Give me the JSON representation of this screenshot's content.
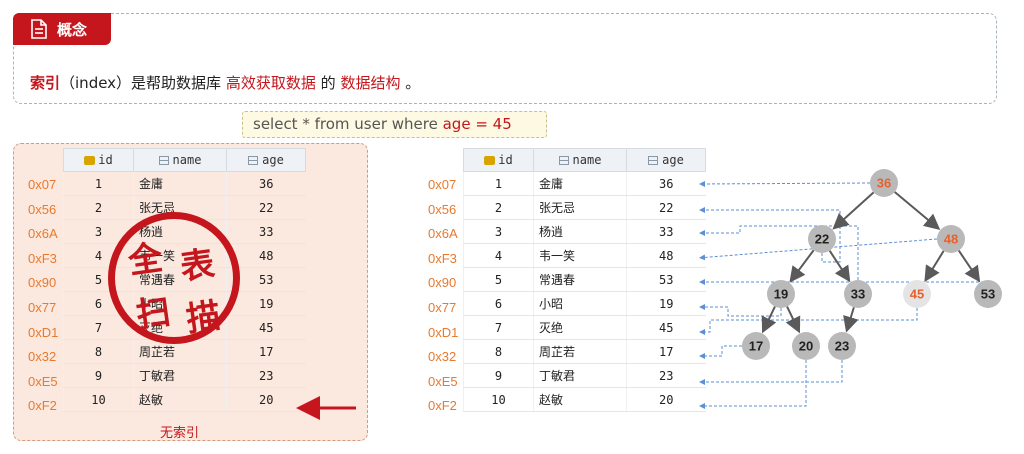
{
  "concept": {
    "tag_label": "概念",
    "definition_prefix": "索引",
    "definition_part1": "（index）是帮助数据库",
    "definition_highlight1": "高效获取数据",
    "definition_part2": "的",
    "definition_highlight2": "数据结构",
    "definition_end": "。"
  },
  "query": {
    "prefix": "select * from user where ",
    "condition": "age = 45"
  },
  "table": {
    "headers": {
      "id": "id",
      "name": "name",
      "age": "age"
    },
    "rows": [
      {
        "addr": "0x07",
        "id": "1",
        "name": "金庸",
        "age": "36"
      },
      {
        "addr": "0x56",
        "id": "2",
        "name": "张无忌",
        "age": "22"
      },
      {
        "addr": "0x6A",
        "id": "3",
        "name": "杨逍",
        "age": "33"
      },
      {
        "addr": "0xF3",
        "id": "4",
        "name": "韦一笑",
        "age": "48"
      },
      {
        "addr": "0x90",
        "id": "5",
        "name": "常遇春",
        "age": "53"
      },
      {
        "addr": "0x77",
        "id": "6",
        "name": "小昭",
        "age": "19"
      },
      {
        "addr": "0xD1",
        "id": "7",
        "name": "灭绝",
        "age": "45"
      },
      {
        "addr": "0x32",
        "id": "8",
        "name": "周芷若",
        "age": "17"
      },
      {
        "addr": "0xE5",
        "id": "9",
        "name": "丁敏君",
        "age": "23"
      },
      {
        "addr": "0xF2",
        "id": "10",
        "name": "赵敏",
        "age": "20"
      }
    ]
  },
  "left_panel": {
    "caption": "无索引",
    "stamp_chars": [
      "全",
      "表",
      "扫",
      "描"
    ]
  },
  "tree": {
    "nodes": [
      "36",
      "22",
      "48",
      "19",
      "33",
      "45",
      "53",
      "17",
      "20",
      "23"
    ]
  },
  "colors": {
    "accent_red": "#c4161c",
    "address_orange": "#e8792e",
    "node_gray": "#b9b9b9",
    "highlight_node_text": "#e8612c",
    "arrow_blue": "#5b8fd6"
  }
}
